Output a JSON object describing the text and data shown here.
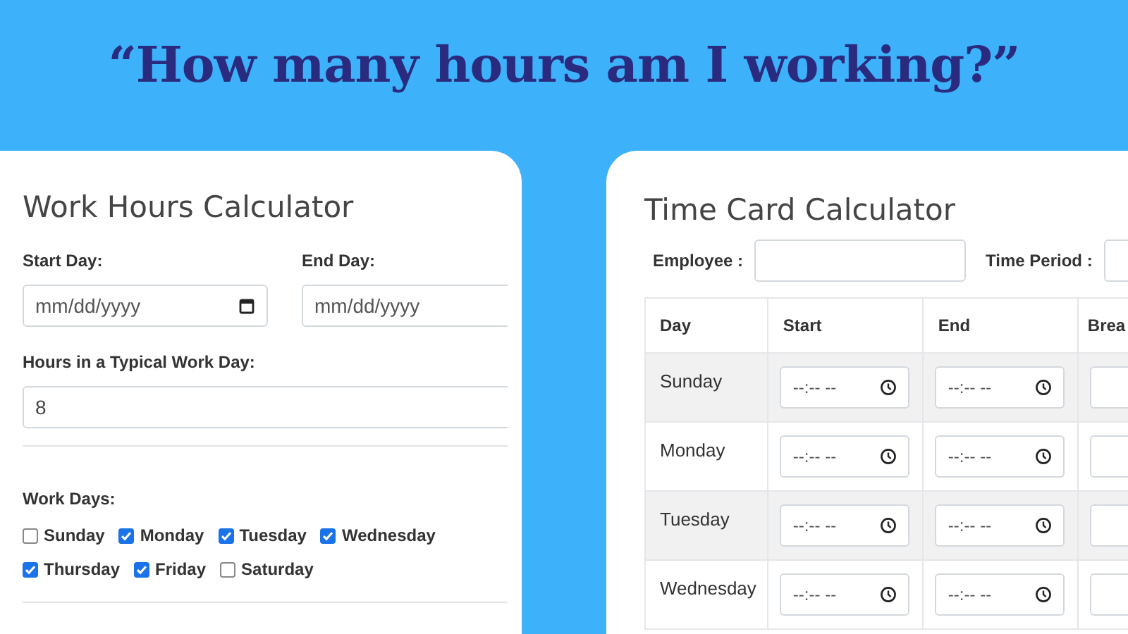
{
  "headline": "“How many hours am I working?”",
  "work_hours_calculator": {
    "title": "Work Hours Calculator",
    "start_day": {
      "label": "Start Day:",
      "placeholder": "mm/dd/yyyy"
    },
    "end_day": {
      "label": "End Day:",
      "placeholder": "mm/dd/yyyy"
    },
    "hours": {
      "label": "Hours in a Typical Work Day:",
      "value": "8"
    },
    "work_days": {
      "label": "Work Days:",
      "days": [
        {
          "label": "Sunday",
          "checked": false
        },
        {
          "label": "Monday",
          "checked": true
        },
        {
          "label": "Tuesday",
          "checked": true
        },
        {
          "label": "Wednesday",
          "checked": true
        },
        {
          "label": "Thursday",
          "checked": true
        },
        {
          "label": "Friday",
          "checked": true
        },
        {
          "label": "Saturday",
          "checked": false
        }
      ]
    }
  },
  "time_card_calculator": {
    "title": "Time Card Calculator",
    "employee": {
      "label": "Employee :"
    },
    "time_period": {
      "label": "Time Period :"
    },
    "table": {
      "columns": [
        "Day",
        "Start",
        "End",
        "Brea"
      ],
      "rows": [
        {
          "day": "Sunday",
          "start": {
            "placeholder": "--:-- --"
          },
          "end": {
            "placeholder": "--:-- --"
          }
        },
        {
          "day": "Monday",
          "start": {
            "placeholder": "--:-- --"
          },
          "end": {
            "placeholder": "--:-- --"
          }
        },
        {
          "day": "Tuesday",
          "start": {
            "placeholder": "--:-- --"
          },
          "end": {
            "placeholder": "--:-- --"
          }
        },
        {
          "day": "Wednesday",
          "start": {
            "placeholder": "--:-- --"
          },
          "end": {
            "placeholder": "--:-- --"
          }
        }
      ]
    }
  }
}
